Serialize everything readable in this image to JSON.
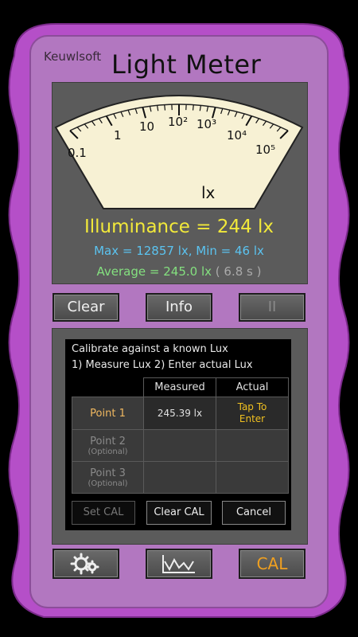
{
  "header": {
    "brand": "Keuwlsoft",
    "title": "Light Meter"
  },
  "meter": {
    "scale_labels": [
      "0.1",
      "1",
      "10",
      "10²",
      "10³",
      "10⁴",
      "10⁵"
    ],
    "unit": "lx",
    "illuminance": "Illuminance = 244 lx",
    "max_min": "Max = 12857 lx,  Min = 46 lx",
    "average": "Average = 245.0 lx",
    "average_time": "( 6.8 s )"
  },
  "buttons": {
    "clear": "Clear",
    "info": "Info",
    "pause": "II"
  },
  "calibration": {
    "line1": "Calibrate against a known Lux",
    "line2": "1) Measure Lux  2) Enter actual Lux",
    "col_measured": "Measured",
    "col_actual": "Actual",
    "point1": "Point 1",
    "point1_measured": "245.39 lx",
    "point1_actual": "Tap To Enter",
    "point2": "Point 2",
    "point3": "Point 3",
    "optional": "(Optional)",
    "set_cal": "Set CAL",
    "clear_cal": "Clear CAL",
    "cancel": "Cancel"
  },
  "bottom": {
    "settings_icon": "gears-icon",
    "graph_icon": "graph-icon",
    "cal": "CAL"
  },
  "colors": {
    "body": "#b277c0",
    "bezel": "#b54fc8",
    "needle": "#d01010",
    "needle_blue": "#7aa6e6",
    "illuminance": "#f2e93a",
    "maxmin": "#5bc3f0",
    "average": "#84e07f",
    "cal_accent": "#f0a020"
  }
}
